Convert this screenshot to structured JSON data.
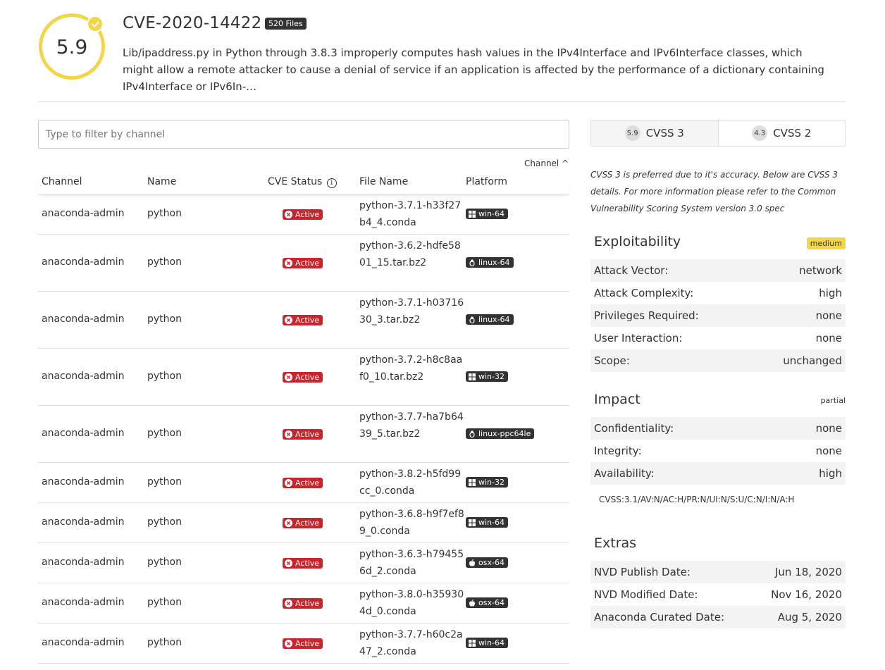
{
  "header": {
    "score": "5.9",
    "cve_id": "CVE-2020-14422",
    "files_badge": "520 Files",
    "description": "Lib/ipaddress.py in Python through 3.8.3 improperly computes hash values in the IPv4Interface and IPv6Interface classes, which might allow a remote attacker to cause a denial of service if an application is affected by the performance of a dictionary containing IPv4Interface or IPv6In-…"
  },
  "filter": {
    "placeholder": "Type to filter by channel"
  },
  "sort": {
    "label": "Channel ^"
  },
  "table": {
    "headers": {
      "channel": "Channel",
      "name": "Name",
      "status": "CVE Status",
      "file": "File Name",
      "platform": "Platform"
    },
    "rows": [
      {
        "channel": "anaconda-admin",
        "name": "python",
        "status": "Active",
        "file": "python-3.7.1-h33f27b4_4.conda",
        "platform": "win-64",
        "os": "windows",
        "height": 57
      },
      {
        "channel": "anaconda-admin",
        "name": "python",
        "status": "Active",
        "file": "python-3.6.2-hdfe5801_15.tar.bz2",
        "platform": "linux-64",
        "os": "linux",
        "height": 81
      },
      {
        "channel": "anaconda-admin",
        "name": "python",
        "status": "Active",
        "file": "python-3.7.1-h0371630_3.tar.bz2",
        "platform": "linux-64",
        "os": "linux",
        "height": 81
      },
      {
        "channel": "anaconda-admin",
        "name": "python",
        "status": "Active",
        "file": "python-3.7.2-h8c8aaf0_10.tar.bz2",
        "platform": "win-32",
        "os": "windows",
        "height": 81
      },
      {
        "channel": "anaconda-admin",
        "name": "python",
        "status": "Active",
        "file": "python-3.7.7-ha7b6439_5.tar.bz2",
        "platform": "linux-ppc64le",
        "os": "linux",
        "height": 81
      },
      {
        "channel": "anaconda-admin",
        "name": "python",
        "status": "Active",
        "file": "python-3.8.2-h5fd99cc_0.conda",
        "platform": "win-32",
        "os": "windows",
        "height": 57
      },
      {
        "channel": "anaconda-admin",
        "name": "python",
        "status": "Active",
        "file": "python-3.6.8-h9f7ef89_0.conda",
        "platform": "win-64",
        "os": "windows",
        "height": 57
      },
      {
        "channel": "anaconda-admin",
        "name": "python",
        "status": "Active",
        "file": "python-3.6.3-h794556d_2.conda",
        "platform": "osx-64",
        "os": "apple",
        "height": 57
      },
      {
        "channel": "anaconda-admin",
        "name": "python",
        "status": "Active",
        "file": "python-3.8.0-h359304d_0.conda",
        "platform": "osx-64",
        "os": "apple",
        "height": 57
      },
      {
        "channel": "anaconda-admin",
        "name": "python",
        "status": "Active",
        "file": "python-3.7.7-h60c2a47_2.conda",
        "platform": "win-64",
        "os": "windows",
        "height": 57
      }
    ]
  },
  "cvss_tabs": [
    {
      "score": "5.9",
      "label": "CVSS 3"
    },
    {
      "score": "4.3",
      "label": "CVSS 2"
    }
  ],
  "cvss_note": "CVSS 3 is preferred due to it's accuracy. Below are CVSS 3 details. For more information please refer to the Common Vulnerability Scoring System version 3.0 spec",
  "exploitability": {
    "title": "Exploitability",
    "badge": "medium",
    "rows": [
      {
        "label": "Attack Vector:",
        "value": "network"
      },
      {
        "label": "Attack Complexity:",
        "value": "high"
      },
      {
        "label": "Privileges Required:",
        "value": "none"
      },
      {
        "label": "User Interaction:",
        "value": "none"
      },
      {
        "label": "Scope:",
        "value": "unchanged"
      }
    ]
  },
  "impact": {
    "title": "Impact",
    "badge": "partial",
    "rows": [
      {
        "label": "Confidentiality:",
        "value": "none"
      },
      {
        "label": "Integrity:",
        "value": "none"
      },
      {
        "label": "Availability:",
        "value": "high"
      }
    ],
    "vector": "CVSS:3.1/AV:N/AC:H/PR:N/UI:N/S:U/C:N/I:N/A:H"
  },
  "extras": {
    "title": "Extras",
    "rows": [
      {
        "label": "NVD Publish Date:",
        "value": "Jun 18, 2020"
      },
      {
        "label": "NVD Modified Date:",
        "value": "Nov 16, 2020"
      },
      {
        "label": "Anaconda Curated Date:",
        "value": "Aug 5, 2020"
      }
    ]
  },
  "colors": {
    "score_ring": "#f2d54a",
    "active_badge": "#c8252c",
    "platform_badge": "#333333"
  }
}
